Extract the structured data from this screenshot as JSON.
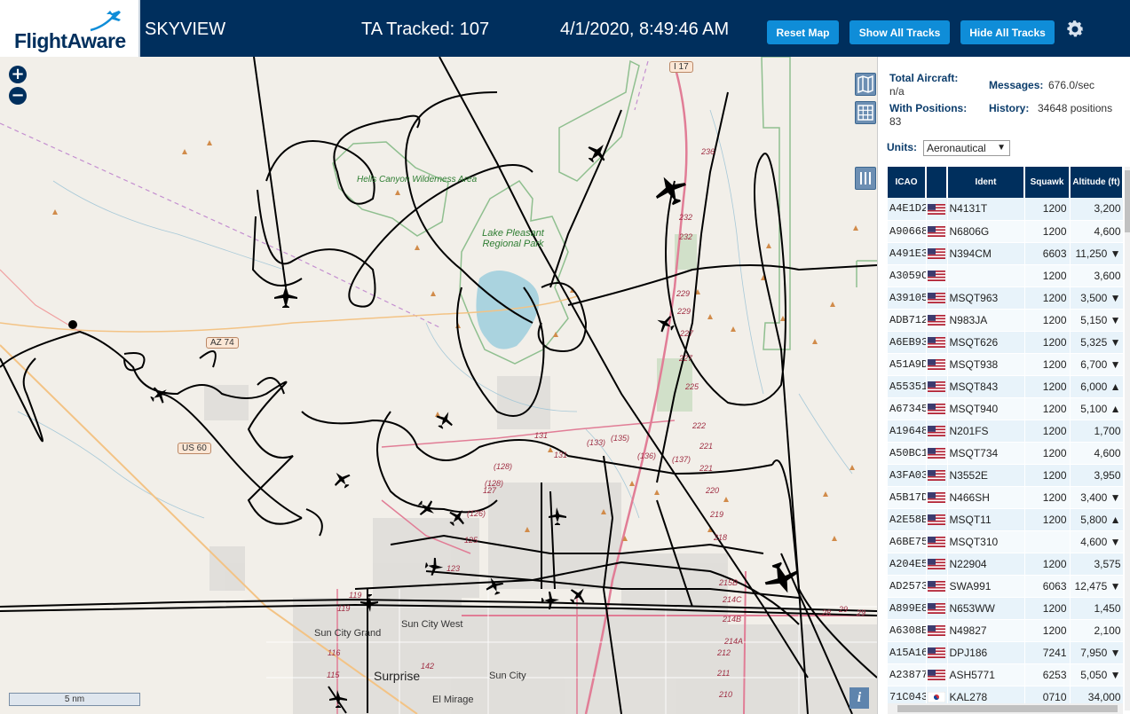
{
  "header": {
    "logo_text": "FlightAware",
    "app_name": "SKYVIEW",
    "ta_tracked": "TA Tracked: 107",
    "datetime": "4/1/2020, 8:49:46 AM",
    "reset_map_label": "Reset Map",
    "show_all_tracks_label": "Show All Tracks",
    "hide_all_tracks_label": "Hide All Tracks",
    "brand_color": "#002f5d",
    "button_color": "#0f8dd8"
  },
  "map": {
    "zoom_in": "+",
    "zoom_out": "−",
    "scale_label": "5 nm",
    "info_label": "i",
    "labels": {
      "hells_canyon": "Hells Canyon Wilderness Area",
      "lake_pleasant": "Lake Pleasant Regional Park",
      "sun_city_grand": "Sun City Grand",
      "sun_city_west": "Sun City West",
      "surprise": "Surprise",
      "sun_city": "Sun City",
      "el_mirage": "El Mirage",
      "az74": "AZ 74",
      "us60": "US 60",
      "i17": "I 17"
    }
  },
  "panel": {
    "total_aircraft_label": "Total Aircraft:",
    "total_aircraft_value": "n/a",
    "with_positions_label": "With Positions:",
    "with_positions_value": "83",
    "messages_label": "Messages:",
    "messages_value": "676.0/sec",
    "history_label": "History:",
    "history_value": "34648 positions",
    "units_label": "Units:",
    "units_value": "Aeronautical",
    "columns": {
      "icao": "ICAO",
      "ident": "Ident",
      "squawk": "Squawk",
      "altitude": "Altitude (ft)"
    },
    "rows": [
      {
        "icao": "A4E1D2",
        "flag": "us",
        "ident": "N4131T",
        "squawk": "1200",
        "alt": "3,200"
      },
      {
        "icao": "A90668",
        "flag": "us",
        "ident": "N6806G",
        "squawk": "1200",
        "alt": "4,600"
      },
      {
        "icao": "A491E3",
        "flag": "us",
        "ident": "N394CM",
        "squawk": "6603",
        "alt": "11,250 ▼"
      },
      {
        "icao": "A3059C",
        "flag": "us",
        "ident": "",
        "squawk": "1200",
        "alt": "3,600"
      },
      {
        "icao": "A39105",
        "flag": "us",
        "ident": "MSQT963",
        "squawk": "1200",
        "alt": "3,500 ▼"
      },
      {
        "icao": "ADB712",
        "flag": "us",
        "ident": "N983JA",
        "squawk": "1200",
        "alt": "5,150 ▼"
      },
      {
        "icao": "A6EB93",
        "flag": "us",
        "ident": "MSQT626",
        "squawk": "1200",
        "alt": "5,325 ▼"
      },
      {
        "icao": "A51A9D",
        "flag": "us",
        "ident": "MSQT938",
        "squawk": "1200",
        "alt": "6,700 ▼"
      },
      {
        "icao": "A55351",
        "flag": "us",
        "ident": "MSQT843",
        "squawk": "1200",
        "alt": "6,000 ▲"
      },
      {
        "icao": "A67345",
        "flag": "us",
        "ident": "MSQT940",
        "squawk": "1200",
        "alt": "5,100 ▲"
      },
      {
        "icao": "A19648",
        "flag": "us",
        "ident": "N201FS",
        "squawk": "1200",
        "alt": "1,700"
      },
      {
        "icao": "A50BC1",
        "flag": "us",
        "ident": "MSQT734",
        "squawk": "1200",
        "alt": "4,600"
      },
      {
        "icao": "A3FA03",
        "flag": "us",
        "ident": "N3552E",
        "squawk": "1200",
        "alt": "3,950"
      },
      {
        "icao": "A5B17D",
        "flag": "us",
        "ident": "N466SH",
        "squawk": "1200",
        "alt": "3,400 ▼"
      },
      {
        "icao": "A2E58B",
        "flag": "us",
        "ident": "MSQT11",
        "squawk": "1200",
        "alt": "5,800 ▲"
      },
      {
        "icao": "A6BE75",
        "flag": "us",
        "ident": "MSQT310",
        "squawk": "",
        "alt": "4,600 ▼"
      },
      {
        "icao": "A204E5",
        "flag": "us",
        "ident": "N22904",
        "squawk": "1200",
        "alt": "3,575"
      },
      {
        "icao": "AD2573",
        "flag": "us",
        "ident": "SWA991",
        "squawk": "6063",
        "alt": "12,475 ▼"
      },
      {
        "icao": "A899E8",
        "flag": "us",
        "ident": "N653WW",
        "squawk": "1200",
        "alt": "1,450"
      },
      {
        "icao": "A6308E",
        "flag": "us",
        "ident": "N49827",
        "squawk": "1200",
        "alt": "2,100"
      },
      {
        "icao": "A15A16",
        "flag": "us",
        "ident": "DPJ186",
        "squawk": "7241",
        "alt": "7,950 ▼"
      },
      {
        "icao": "A23877",
        "flag": "us",
        "ident": "ASH5771",
        "squawk": "6253",
        "alt": "5,050 ▼"
      },
      {
        "icao": "71C043",
        "flag": "kr",
        "ident": "KAL278",
        "squawk": "0710",
        "alt": "34,000"
      }
    ]
  }
}
